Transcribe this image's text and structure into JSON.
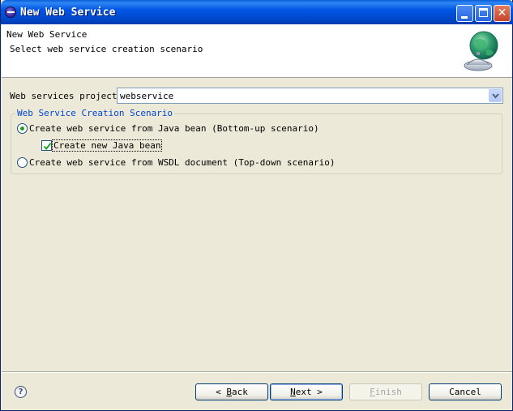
{
  "window": {
    "title": "New Web Service",
    "minimize_icon": "minimize-icon",
    "maximize_icon": "maximize-icon",
    "close_icon": "close-icon"
  },
  "header": {
    "title": "New Web Service",
    "description": "Select web service creation scenario",
    "art_icon": "web-service-globe-icon"
  },
  "project": {
    "label": "Web services project:",
    "value": "webservice"
  },
  "scenario_group": {
    "legend": "Web Service Creation Scenario",
    "options": [
      {
        "label": "Create web service from Java bean (Bottom-up scenario)",
        "selected": true
      },
      {
        "label": "Create web service from WSDL document (Top-down scenario)",
        "selected": false
      }
    ],
    "checkbox": {
      "label": "Create new Java bean",
      "checked": true
    }
  },
  "footer": {
    "help_icon": "help-icon",
    "back": {
      "arrow": "<",
      "mnemonic": "B",
      "rest": "ack"
    },
    "next": {
      "mnemonic": "N",
      "rest": "ext",
      "arrow": ">"
    },
    "finish": {
      "mnemonic": "F",
      "rest": "inish",
      "enabled": false
    },
    "cancel": {
      "label": "Cancel"
    }
  },
  "colors": {
    "titlebar": "#0055e5",
    "group_legend": "#0046d5",
    "window_bg": "#ece9d8"
  }
}
